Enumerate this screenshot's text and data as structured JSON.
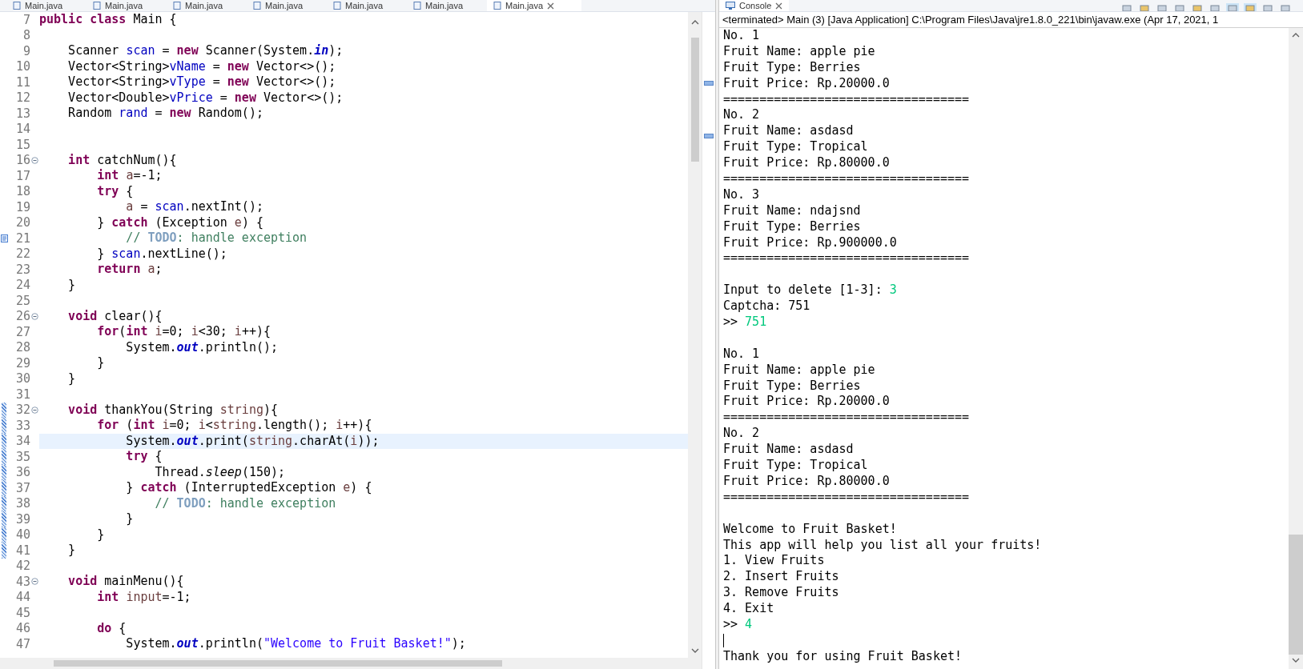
{
  "editor": {
    "tabs": [
      {
        "label": "Main.java",
        "selected": false
      },
      {
        "label": "Main.java",
        "selected": false
      },
      {
        "label": "Main.java",
        "selected": false
      },
      {
        "label": "Main.java",
        "selected": false
      },
      {
        "label": "Main.java",
        "selected": false
      },
      {
        "label": "Main.java",
        "selected": false
      },
      {
        "label": "Main.java",
        "selected": true
      }
    ],
    "lines": [
      {
        "number": "7",
        "fold": false,
        "current": false,
        "range": false,
        "task": false,
        "tokens": [
          {
            "kind": "keyword",
            "text": "public "
          },
          {
            "kind": "keyword",
            "text": "class"
          },
          {
            "kind": "plain",
            "text": " Main {"
          }
        ]
      },
      {
        "number": "8",
        "fold": false,
        "current": false,
        "range": false,
        "task": false
      },
      {
        "number": "9",
        "fold": false,
        "current": false,
        "range": false,
        "task": false,
        "tokens": [
          {
            "kind": "plain",
            "text": "    Scanner "
          },
          {
            "kind": "field",
            "text": "scan"
          },
          {
            "kind": "plain",
            "text": " = "
          },
          {
            "kind": "keyword",
            "text": "new"
          },
          {
            "kind": "plain",
            "text": " Scanner(System."
          },
          {
            "kind": "static",
            "text": "in"
          },
          {
            "kind": "plain",
            "text": ");"
          }
        ]
      },
      {
        "number": "10",
        "fold": false,
        "current": false,
        "range": false,
        "task": false,
        "tokens": [
          {
            "kind": "plain",
            "text": "    Vector<String>"
          },
          {
            "kind": "field",
            "text": "vName"
          },
          {
            "kind": "plain",
            "text": " = "
          },
          {
            "kind": "keyword",
            "text": "new"
          },
          {
            "kind": "plain",
            "text": " Vector<>();"
          }
        ]
      },
      {
        "number": "11",
        "fold": false,
        "current": false,
        "range": false,
        "task": false,
        "tokens": [
          {
            "kind": "plain",
            "text": "    Vector<String>"
          },
          {
            "kind": "field",
            "text": "vType"
          },
          {
            "kind": "plain",
            "text": " = "
          },
          {
            "kind": "keyword",
            "text": "new"
          },
          {
            "kind": "plain",
            "text": " Vector<>();"
          }
        ]
      },
      {
        "number": "12",
        "fold": false,
        "current": false,
        "range": false,
        "task": false,
        "tokens": [
          {
            "kind": "plain",
            "text": "    Vector<Double>"
          },
          {
            "kind": "field",
            "text": "vPrice"
          },
          {
            "kind": "plain",
            "text": " = "
          },
          {
            "kind": "keyword",
            "text": "new"
          },
          {
            "kind": "plain",
            "text": " Vector<>();"
          }
        ]
      },
      {
        "number": "13",
        "fold": false,
        "current": false,
        "range": false,
        "task": false,
        "tokens": [
          {
            "kind": "plain",
            "text": "    Random "
          },
          {
            "kind": "field",
            "text": "rand"
          },
          {
            "kind": "plain",
            "text": " = "
          },
          {
            "kind": "keyword",
            "text": "new"
          },
          {
            "kind": "plain",
            "text": " Random();"
          }
        ]
      },
      {
        "number": "14",
        "fold": false,
        "current": false,
        "range": false,
        "task": false
      },
      {
        "number": "15",
        "fold": false,
        "current": false,
        "range": false,
        "task": false
      },
      {
        "number": "16",
        "fold": true,
        "current": false,
        "range": false,
        "task": false,
        "tokens": [
          {
            "kind": "keyword",
            "text": "    int"
          },
          {
            "kind": "plain",
            "text": " catchNum(){"
          }
        ]
      },
      {
        "number": "17",
        "fold": false,
        "current": false,
        "range": false,
        "task": false,
        "tokens": [
          {
            "kind": "keyword",
            "text": "        int "
          },
          {
            "kind": "local",
            "text": "a"
          },
          {
            "kind": "plain",
            "text": "=-1;"
          }
        ]
      },
      {
        "number": "18",
        "fold": false,
        "current": false,
        "range": false,
        "task": false,
        "tokens": [
          {
            "kind": "keyword",
            "text": "        try"
          },
          {
            "kind": "plain",
            "text": " {"
          }
        ]
      },
      {
        "number": "19",
        "fold": false,
        "current": false,
        "range": false,
        "task": false,
        "tokens": [
          {
            "kind": "local",
            "text": "            a"
          },
          {
            "kind": "plain",
            "text": " = "
          },
          {
            "kind": "field",
            "text": "scan"
          },
          {
            "kind": "plain",
            "text": ".nextInt();"
          }
        ]
      },
      {
        "number": "20",
        "fold": false,
        "current": false,
        "range": false,
        "task": false,
        "tokens": [
          {
            "kind": "plain",
            "text": "        } "
          },
          {
            "kind": "keyword",
            "text": "catch"
          },
          {
            "kind": "plain",
            "text": " (Exception "
          },
          {
            "kind": "local",
            "text": "e"
          },
          {
            "kind": "plain",
            "text": ") {"
          }
        ]
      },
      {
        "number": "21",
        "fold": false,
        "current": false,
        "range": false,
        "task": true,
        "tokens": [
          {
            "kind": "comment",
            "text": "            // "
          },
          {
            "kind": "todo",
            "text": "TODO"
          },
          {
            "kind": "comment",
            "text": ": handle exception"
          }
        ]
      },
      {
        "number": "22",
        "fold": false,
        "current": false,
        "range": false,
        "task": false,
        "tokens": [
          {
            "kind": "plain",
            "text": "        } "
          },
          {
            "kind": "field",
            "text": "scan"
          },
          {
            "kind": "plain",
            "text": ".nextLine();"
          }
        ]
      },
      {
        "number": "23",
        "fold": false,
        "current": false,
        "range": false,
        "task": false,
        "tokens": [
          {
            "kind": "keyword",
            "text": "        return "
          },
          {
            "kind": "local",
            "text": "a"
          },
          {
            "kind": "plain",
            "text": ";"
          }
        ]
      },
      {
        "number": "24",
        "fold": false,
        "current": false,
        "range": false,
        "task": false,
        "tokens": [
          {
            "kind": "plain",
            "text": "    }"
          }
        ]
      },
      {
        "number": "25",
        "fold": false,
        "current": false,
        "range": false,
        "task": false
      },
      {
        "number": "26",
        "fold": true,
        "current": false,
        "range": false,
        "task": false,
        "tokens": [
          {
            "kind": "keyword",
            "text": "    void"
          },
          {
            "kind": "plain",
            "text": " clear(){"
          }
        ]
      },
      {
        "number": "27",
        "fold": false,
        "current": false,
        "range": false,
        "task": false,
        "tokens": [
          {
            "kind": "keyword",
            "text": "        for"
          },
          {
            "kind": "plain",
            "text": "("
          },
          {
            "kind": "keyword",
            "text": "int "
          },
          {
            "kind": "local",
            "text": "i"
          },
          {
            "kind": "plain",
            "text": "=0; "
          },
          {
            "kind": "local",
            "text": "i"
          },
          {
            "kind": "plain",
            "text": "<30; "
          },
          {
            "kind": "local",
            "text": "i"
          },
          {
            "kind": "plain",
            "text": "++){"
          }
        ]
      },
      {
        "number": "28",
        "fold": false,
        "current": false,
        "range": false,
        "task": false,
        "tokens": [
          {
            "kind": "plain",
            "text": "            System."
          },
          {
            "kind": "static",
            "text": "out"
          },
          {
            "kind": "plain",
            "text": ".println();"
          }
        ]
      },
      {
        "number": "29",
        "fold": false,
        "current": false,
        "range": false,
        "task": false,
        "tokens": [
          {
            "kind": "plain",
            "text": "        }"
          }
        ]
      },
      {
        "number": "30",
        "fold": false,
        "current": false,
        "range": false,
        "task": false,
        "tokens": [
          {
            "kind": "plain",
            "text": "    }"
          }
        ]
      },
      {
        "number": "31",
        "fold": false,
        "current": false,
        "range": false,
        "task": false
      },
      {
        "number": "32",
        "fold": true,
        "current": false,
        "range": true,
        "task": false,
        "tokens": [
          {
            "kind": "keyword",
            "text": "    void"
          },
          {
            "kind": "plain",
            "text": " thankYou(String "
          },
          {
            "kind": "local",
            "text": "string"
          },
          {
            "kind": "plain",
            "text": "){"
          }
        ]
      },
      {
        "number": "33",
        "fold": false,
        "current": false,
        "range": true,
        "task": false,
        "tokens": [
          {
            "kind": "keyword",
            "text": "        for"
          },
          {
            "kind": "plain",
            "text": " ("
          },
          {
            "kind": "keyword",
            "text": "int "
          },
          {
            "kind": "local",
            "text": "i"
          },
          {
            "kind": "plain",
            "text": "=0; "
          },
          {
            "kind": "local",
            "text": "i"
          },
          {
            "kind": "plain",
            "text": "<"
          },
          {
            "kind": "local",
            "text": "string"
          },
          {
            "kind": "plain",
            "text": ".length(); "
          },
          {
            "kind": "local",
            "text": "i"
          },
          {
            "kind": "plain",
            "text": "++){"
          }
        ]
      },
      {
        "number": "34",
        "fold": false,
        "current": true,
        "range": true,
        "task": false,
        "tokens": [
          {
            "kind": "plain",
            "text": "            System."
          },
          {
            "kind": "static",
            "text": "out"
          },
          {
            "kind": "plain",
            "text": ".print("
          },
          {
            "kind": "local",
            "text": "string"
          },
          {
            "kind": "plain",
            "text": ".charAt("
          },
          {
            "kind": "local",
            "text": "i"
          },
          {
            "kind": "plain",
            "text": "));"
          }
        ]
      },
      {
        "number": "35",
        "fold": false,
        "current": false,
        "range": true,
        "task": false,
        "tokens": [
          {
            "kind": "keyword",
            "text": "            try"
          },
          {
            "kind": "plain",
            "text": " {"
          }
        ]
      },
      {
        "number": "36",
        "fold": false,
        "current": false,
        "range": true,
        "task": false,
        "tokens": [
          {
            "kind": "plain",
            "text": "                Thread."
          },
          {
            "kind": "method",
            "text": "sleep"
          },
          {
            "kind": "plain",
            "text": "(150);"
          }
        ]
      },
      {
        "number": "37",
        "fold": false,
        "current": false,
        "range": true,
        "task": false,
        "tokens": [
          {
            "kind": "plain",
            "text": "            } "
          },
          {
            "kind": "keyword",
            "text": "catch"
          },
          {
            "kind": "plain",
            "text": " (InterruptedException "
          },
          {
            "kind": "local",
            "text": "e"
          },
          {
            "kind": "plain",
            "text": ") {"
          }
        ]
      },
      {
        "number": "38",
        "fold": false,
        "current": false,
        "range": true,
        "task": true,
        "tokens": [
          {
            "kind": "comment",
            "text": "                // "
          },
          {
            "kind": "todo",
            "text": "TODO"
          },
          {
            "kind": "comment",
            "text": ": handle exception"
          }
        ]
      },
      {
        "number": "39",
        "fold": false,
        "current": false,
        "range": true,
        "task": false,
        "tokens": [
          {
            "kind": "plain",
            "text": "            }"
          }
        ]
      },
      {
        "number": "40",
        "fold": false,
        "current": false,
        "range": true,
        "task": false,
        "tokens": [
          {
            "kind": "plain",
            "text": "        }"
          }
        ]
      },
      {
        "number": "41",
        "fold": false,
        "current": false,
        "range": true,
        "task": false,
        "tokens": [
          {
            "kind": "plain",
            "text": "    }"
          }
        ]
      },
      {
        "number": "42",
        "fold": false,
        "current": false,
        "range": false,
        "task": false
      },
      {
        "number": "43",
        "fold": true,
        "current": false,
        "range": false,
        "task": false,
        "tokens": [
          {
            "kind": "keyword",
            "text": "    void"
          },
          {
            "kind": "plain",
            "text": " mainMenu(){"
          }
        ]
      },
      {
        "number": "44",
        "fold": false,
        "current": false,
        "range": false,
        "task": false,
        "tokens": [
          {
            "kind": "keyword",
            "text": "        int "
          },
          {
            "kind": "local",
            "text": "input"
          },
          {
            "kind": "plain",
            "text": "=-1;"
          }
        ]
      },
      {
        "number": "45",
        "fold": false,
        "current": false,
        "range": false,
        "task": false
      },
      {
        "number": "46",
        "fold": false,
        "current": false,
        "range": false,
        "task": false,
        "tokens": [
          {
            "kind": "keyword",
            "text": "        do"
          },
          {
            "kind": "plain",
            "text": " {"
          }
        ]
      },
      {
        "number": "47",
        "fold": false,
        "current": false,
        "range": false,
        "task": false,
        "tokens": [
          {
            "kind": "plain",
            "text": "            System."
          },
          {
            "kind": "static",
            "text": "out"
          },
          {
            "kind": "plain",
            "text": ".println("
          },
          {
            "kind": "string",
            "text": "\"Welcome to Fruit Basket!\""
          },
          {
            "kind": "plain",
            "text": ");"
          }
        ]
      }
    ]
  },
  "console": {
    "tab": {
      "label": "Console",
      "selected": true
    },
    "title": "<terminated> Main (3) [Java Application] C:\\Program Files\\Java\\jre1.8.0_221\\bin\\javaw.exe (Apr 17, 2021, 1",
    "lines": [
      {
        "kind": "text",
        "text": "No. 1"
      },
      {
        "kind": "text",
        "text": "Fruit Name: apple pie"
      },
      {
        "kind": "text",
        "text": "Fruit Type: Berries"
      },
      {
        "kind": "text",
        "text": "Fruit Price: Rp.20000.0"
      },
      {
        "kind": "text",
        "text": "=================================="
      },
      {
        "kind": "text",
        "text": "No. 2"
      },
      {
        "kind": "text",
        "text": "Fruit Name: asdasd"
      },
      {
        "kind": "text",
        "text": "Fruit Type: Tropical"
      },
      {
        "kind": "text",
        "text": "Fruit Price: Rp.80000.0"
      },
      {
        "kind": "text",
        "text": "=================================="
      },
      {
        "kind": "text",
        "text": "No. 3"
      },
      {
        "kind": "text",
        "text": "Fruit Name: ndajsnd"
      },
      {
        "kind": "text",
        "text": "Fruit Type: Berries"
      },
      {
        "kind": "text",
        "text": "Fruit Price: Rp.900000.0"
      },
      {
        "kind": "text",
        "text": "=================================="
      },
      {
        "kind": "blank"
      },
      {
        "kind": "text",
        "text": "Input to delete [1-3]: ",
        "input": "3"
      },
      {
        "kind": "text",
        "text": "Captcha: 751"
      },
      {
        "kind": "text",
        "text": ">> ",
        "input": "751"
      },
      {
        "kind": "blank"
      },
      {
        "kind": "text",
        "text": "No. 1"
      },
      {
        "kind": "text",
        "text": "Fruit Name: apple pie"
      },
      {
        "kind": "text",
        "text": "Fruit Type: Berries"
      },
      {
        "kind": "text",
        "text": "Fruit Price: Rp.20000.0"
      },
      {
        "kind": "text",
        "text": "=================================="
      },
      {
        "kind": "text",
        "text": "No. 2"
      },
      {
        "kind": "text",
        "text": "Fruit Name: asdasd"
      },
      {
        "kind": "text",
        "text": "Fruit Type: Tropical"
      },
      {
        "kind": "text",
        "text": "Fruit Price: Rp.80000.0"
      },
      {
        "kind": "text",
        "text": "=================================="
      },
      {
        "kind": "blank"
      },
      {
        "kind": "text",
        "text": "Welcome to Fruit Basket!"
      },
      {
        "kind": "text",
        "text": "This app will help you list all your fruits!"
      },
      {
        "kind": "text",
        "text": "1. View Fruits"
      },
      {
        "kind": "text",
        "text": "2. Insert Fruits"
      },
      {
        "kind": "text",
        "text": "3. Remove Fruits"
      },
      {
        "kind": "text",
        "text": "4. Exit"
      },
      {
        "kind": "text",
        "text": ">> ",
        "input": "4"
      },
      {
        "kind": "cursor"
      },
      {
        "kind": "text",
        "text": "Thank you for using Fruit Basket!"
      }
    ]
  }
}
